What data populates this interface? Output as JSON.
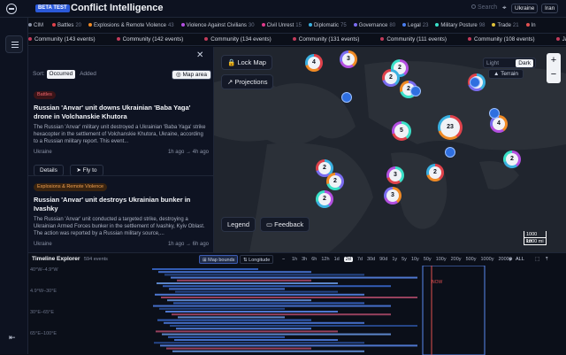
{
  "app": {
    "badge": "BETA TEST",
    "title": "Conflict Intelligence"
  },
  "topbar": {
    "search_placeholder": "Search",
    "countries": [
      "Ukraine",
      "Iran"
    ]
  },
  "categories": [
    {
      "label": "CIM",
      "count": "",
      "color": "#8a92a6"
    },
    {
      "label": "Battles",
      "count": "20",
      "color": "#e0424b"
    },
    {
      "label": "Explosions & Remote Violence",
      "count": "43",
      "color": "#f08a24"
    },
    {
      "label": "Violence Against Civilians",
      "count": "30",
      "color": "#b34fe0"
    },
    {
      "label": "Civil Unrest",
      "count": "15",
      "color": "#e03a8a"
    },
    {
      "label": "Diplomatic",
      "count": "75",
      "color": "#3ab0e0"
    },
    {
      "label": "Governance",
      "count": "80",
      "color": "#7a6cf0"
    },
    {
      "label": "Legal",
      "count": "23",
      "color": "#4a7ef0"
    },
    {
      "label": "Military Posture",
      "count": "98",
      "color": "#3ae0c8"
    },
    {
      "label": "Trade",
      "count": "21",
      "color": "#e0c23a"
    },
    {
      "label": "In",
      "count": "",
      "color": "#e05050"
    }
  ],
  "communities": [
    "Community (143 events)",
    "Community (142 events)",
    "Community (134 events)",
    "Community (131 events)",
    "Community (111 events)",
    "Community (108 events)",
    "Japan's Strategic P"
  ],
  "panel": {
    "sort_label": "Sort:",
    "sort_options": [
      "Occurred",
      "Added"
    ],
    "map_area_label": "Map area",
    "cards": [
      {
        "category": "Battles",
        "category_color": "#e0424b",
        "title": "Russian 'Anvar' unit downs Ukrainian 'Baba Yaga' drone in Volchanskie Khutora",
        "body": "The Russian 'Anvar' military unit destroyed a Ukrainian 'Baba Yaga' strike hexacopter in the settlement of Volchanskie Khutora, Ukraine, according to a Russian military report. This event...",
        "country": "Ukraine",
        "time": "1h ago → 4h ago",
        "details_label": "Details",
        "fly_label": "Fly to"
      },
      {
        "category": "Explosions & Remote Violence",
        "category_color": "#f08a24",
        "title": "Russian 'Anvar' unit destroys Ukrainian bunker in Ivashky",
        "body": "The Russian 'Anvar' unit conducted a targeted strike, destroying a Ukrainian Armed Forces bunker in the settlement of Ivashky, Kyiv Oblast. The action was reported by a Russian military source,...",
        "country": "Ukraine",
        "time": "1h ago → 6h ago"
      }
    ]
  },
  "map": {
    "lock_label": "Lock Map",
    "projections_label": "Projections",
    "theme_light": "Light",
    "theme_dark": "Dark",
    "terrain_label": "Terrain",
    "legend_label": "Legend",
    "feedback_label": "Feedback",
    "scale_km": "1000 km",
    "scale_mi": "1000 mi",
    "clusters": [
      {
        "n": "4"
      },
      {
        "n": "3"
      },
      {
        "n": "2"
      },
      {
        "n": "2"
      },
      {
        "n": "2"
      },
      {
        "n": "5"
      },
      {
        "n": "23"
      },
      {
        "n": "4"
      },
      {
        "n": "2"
      },
      {
        "n": "2"
      },
      {
        "n": "2"
      },
      {
        "n": "3"
      },
      {
        "n": "2"
      },
      {
        "n": "3"
      },
      {
        "n": "2"
      },
      {
        "n": "2"
      }
    ]
  },
  "timeline": {
    "title": "Timeline Explorer",
    "count": "594 events",
    "map_bounds_label": "Map bounds",
    "longitude_label": "Longitude",
    "ranges": [
      "1h",
      "3h",
      "6h",
      "12h",
      "1d",
      "2d",
      "7d",
      "30d",
      "90d",
      "1y",
      "5y",
      "10y",
      "50y",
      "100y",
      "200y",
      "500y",
      "1000y",
      "2000y"
    ],
    "active_range": "2d",
    "all_label": "ALL",
    "row_labels": [
      "40°W–4.9°W",
      "4.9°W–30°E",
      "30°E–65°E",
      "65°E–100°E"
    ],
    "now_label": "NOW"
  }
}
